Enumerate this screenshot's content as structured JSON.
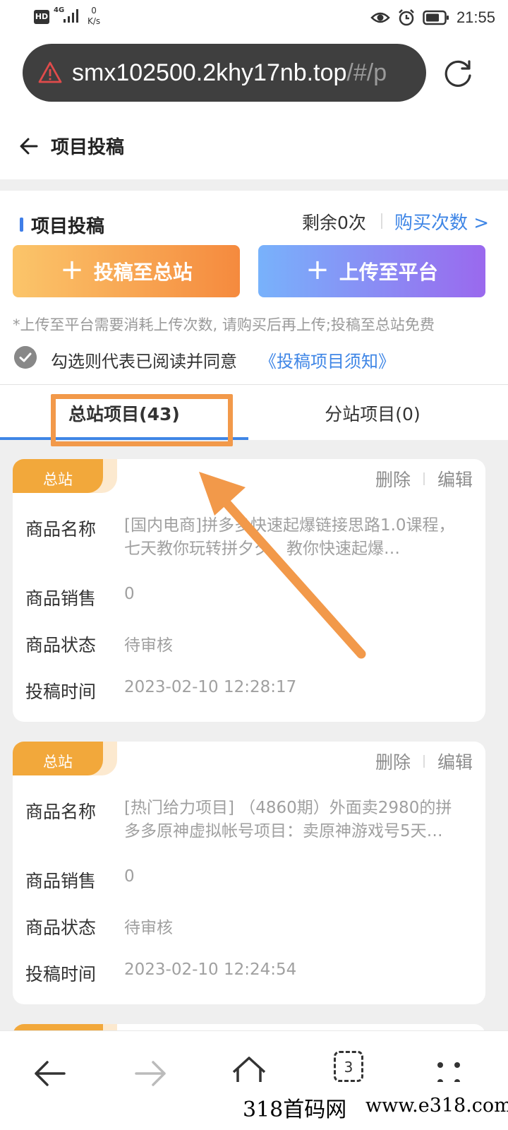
{
  "status_bar": {
    "hd": "HD",
    "network": "4G",
    "speed_value": "0",
    "speed_unit": "K/s",
    "time": "21:55"
  },
  "url_bar": {
    "url_main": "smx102500.2khy17nb.top",
    "url_dim": "/#/p",
    "warning_icon": "warning-triangle-icon",
    "reload_icon": "reload-icon"
  },
  "header": {
    "title": "项目投稿",
    "back_icon": "back-arrow-icon"
  },
  "submit_section": {
    "title": "项目投稿",
    "remaining": "剩余0次",
    "buy_link": "购买次数 >",
    "btn_submit_main": "投稿至总站",
    "btn_upload_platform": "上传至平台",
    "note": "*上传至平台需要消耗上传次数, 请购买后再上传;投稿至总站免费",
    "agree_text": "勾选则代表已阅读并同意",
    "agree_link": "《投稿项目须知》",
    "accent_color": "#3f86e6"
  },
  "tabs": [
    {
      "label": "总站项目(43)",
      "active": true
    },
    {
      "label": "分站项目(0)",
      "active": false
    }
  ],
  "labels": {
    "name": "商品名称",
    "sales": "商品销售",
    "status": "商品状态",
    "time": "投稿时间",
    "delete": "删除",
    "edit": "编辑"
  },
  "items": [
    {
      "badge": "总站",
      "name": "[国内电商]拼多多快速起爆链接思路1.0课程，七天教你玩转拼夕夕，教你快速起爆…",
      "sales": "0",
      "status": "待审核",
      "time": "2023-02-10 12:28:17"
    },
    {
      "badge": "总站",
      "name": "[热门给力项目] （4860期）外面卖2980的拼多多原神虚拟帐号项目：卖原神游戏号5天…",
      "sales": "0",
      "status": "待审核",
      "time": "2023-02-10 12:24:54"
    }
  ],
  "bottom_nav": {
    "tab_count": "3",
    "icons": [
      "back-icon",
      "forward-icon",
      "home-icon",
      "tabs-icon",
      "menu-icon"
    ]
  },
  "watermark": {
    "left": "318首码网",
    "right": "www.e318.com"
  },
  "annotation_color": "#f2994a"
}
